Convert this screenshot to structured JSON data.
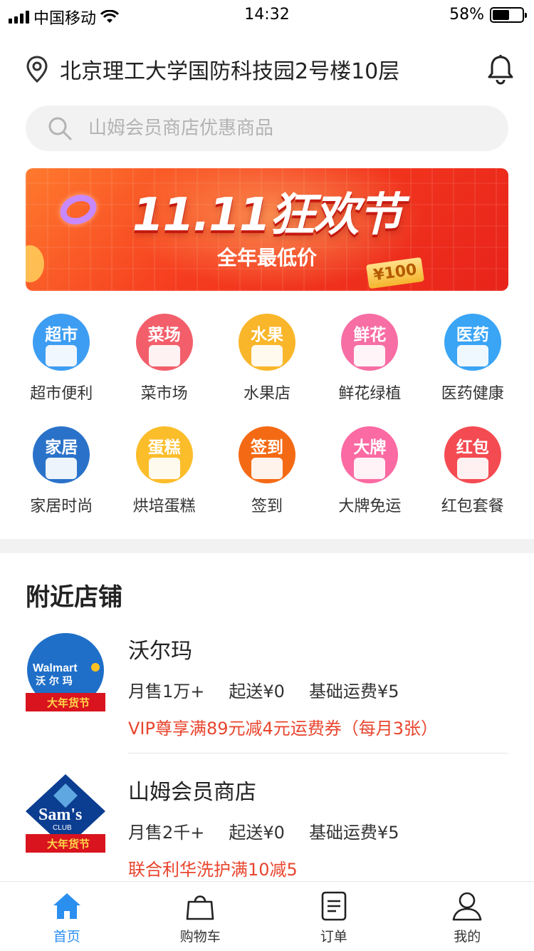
{
  "status_bar": {
    "carrier": "中国移动",
    "time": "14:32",
    "battery": "58%",
    "battery_level": 0.58
  },
  "header": {
    "address": "北京理工大学国防科技园2号楼10层"
  },
  "search": {
    "placeholder": "山姆会员商店优惠商品"
  },
  "banner": {
    "title": "11.11狂欢节",
    "subtitle": "全年最低价",
    "coupon": "¥100"
  },
  "categories": [
    {
      "icon_text": "超市",
      "label": "超市便利",
      "color": "#3d9df2"
    },
    {
      "icon_text": "菜场",
      "label": "菜市场",
      "color": "#f25f6b"
    },
    {
      "icon_text": "水果",
      "label": "水果店",
      "color": "#f9b62a"
    },
    {
      "icon_text": "鲜花",
      "label": "鲜花绿植",
      "color": "#f76ea4"
    },
    {
      "icon_text": "医药",
      "label": "医药健康",
      "color": "#3aa4f5"
    },
    {
      "icon_text": "家居",
      "label": "家居时尚",
      "color": "#2a72c9"
    },
    {
      "icon_text": "蛋糕",
      "label": "烘培蛋糕",
      "color": "#fbbd2a"
    },
    {
      "icon_text": "签到",
      "label": "签到",
      "color": "#f46a14"
    },
    {
      "icon_text": "大牌",
      "label": "大牌免运",
      "color": "#fb6aa2"
    },
    {
      "icon_text": "红包",
      "label": "红包套餐",
      "color": "#f44b52"
    }
  ],
  "nearby": {
    "title": "附近店铺",
    "stores": [
      {
        "name": "沃尔玛",
        "monthly_sales": "月售1万+",
        "min_order": "起送¥0",
        "delivery_fee": "基础运费¥5",
        "promo": "VIP尊享满89元减4元运费券（每月3张）",
        "logo_text": "Walmart",
        "logo_sub": "沃 尔 玛",
        "logo_banner": "大年货节"
      },
      {
        "name": "山姆会员商店",
        "monthly_sales": "月售2千+",
        "min_order": "起送¥0",
        "delivery_fee": "基础运费¥5",
        "promo": "联合利华洗护满10减5",
        "logo_text": "Sam's",
        "logo_sub": "CLUB",
        "logo_banner": "大年货节"
      }
    ]
  },
  "tabbar": {
    "tabs": [
      {
        "label": "首页",
        "icon": "home-icon",
        "active": true
      },
      {
        "label": "购物车",
        "icon": "bag-icon"
      },
      {
        "label": "订单",
        "icon": "order-icon"
      },
      {
        "label": "我的",
        "icon": "user-icon"
      }
    ],
    "active_color": "#2b8ff0"
  }
}
